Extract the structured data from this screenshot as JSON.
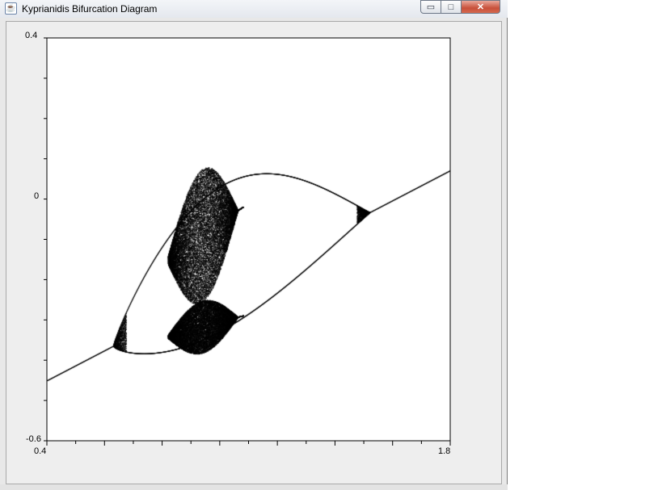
{
  "window": {
    "title": "Kyprianidis Bifurcation Diagram",
    "icon": "java-coffee-cup-icon",
    "controls": {
      "minimize_icon": "minimize-icon",
      "maximize_icon": "maximize-icon",
      "close_icon": "close-icon",
      "minimize_glyph": "▭",
      "maximize_glyph": "□",
      "close_glyph": "✕"
    }
  },
  "chart_data": {
    "type": "scatter",
    "title": "",
    "xlabel": "",
    "ylabel": "",
    "xlim": [
      0.4,
      1.8
    ],
    "ylim": [
      -0.6,
      0.4
    ],
    "x_tick_labels": [
      "0.4",
      "1.8"
    ],
    "y_tick_labels": [
      "0.4",
      "0",
      "-0.6"
    ],
    "x_minor_ticks": 14,
    "y_minor_ticks": 10,
    "grid": false,
    "marker_color": "#000000",
    "background": "#ffffff",
    "features": [
      {
        "name": "period-doubling-1",
        "x": 0.61,
        "y": -0.39
      },
      {
        "name": "period-doubling-2",
        "x": 1.51,
        "y": 0.0
      },
      {
        "name": "chaotic-band-upper",
        "x_range": [
          0.82,
          1.08
        ],
        "y_range": [
          -0.25,
          0.08
        ]
      },
      {
        "name": "chaotic-band-lower",
        "x_range": [
          0.82,
          1.08
        ],
        "y_range": [
          -0.38,
          -0.25
        ]
      }
    ]
  }
}
